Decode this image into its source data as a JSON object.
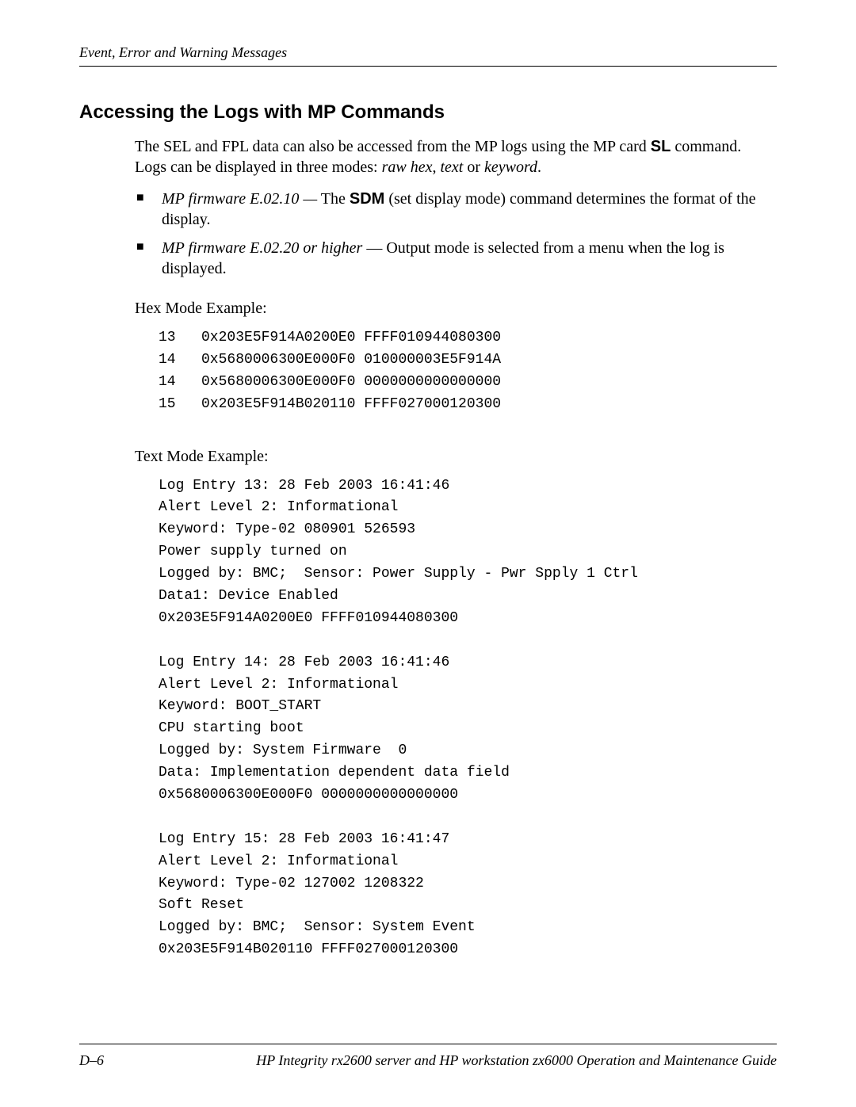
{
  "header": {
    "text": "Event, Error and Warning Messages"
  },
  "section": {
    "title": "Accessing the Logs with MP Commands",
    "intro_part1": "The SEL and FPL data can also be accessed from the MP logs using the MP card ",
    "intro_bold1": "SL",
    "intro_part2": " command. Logs can be displayed in three modes: ",
    "intro_mode1": "raw hex",
    "intro_sep1": ", ",
    "intro_mode2": "text",
    "intro_sep2": " or ",
    "intro_mode3": "keyword",
    "intro_end": "."
  },
  "bullets": {
    "b1_em": "MP firmware E.02.10 —",
    "b1_pre": " The ",
    "b1_bold": "SDM",
    "b1_rest": " (set display mode) command determines the format of the display.",
    "b2_em": "MP firmware E.02.20 or higher",
    "b2_rest": " — Output mode is selected from a menu when the log is displayed."
  },
  "hex": {
    "label": "Hex Mode Example:",
    "lines": "13   0x203E5F914A0200E0 FFFF010944080300\n14   0x5680006300E000F0 010000003E5F914A\n14   0x5680006300E000F0 0000000000000000\n15   0x203E5F914B020110 FFFF027000120300"
  },
  "text": {
    "label": "Text Mode Example:",
    "lines": "Log Entry 13: 28 Feb 2003 16:41:46\nAlert Level 2: Informational\nKeyword: Type-02 080901 526593\nPower supply turned on\nLogged by: BMC;  Sensor: Power Supply - Pwr Spply 1 Ctrl\nData1: Device Enabled\n0x203E5F914A0200E0 FFFF010944080300\n\nLog Entry 14: 28 Feb 2003 16:41:46\nAlert Level 2: Informational\nKeyword: BOOT_START\nCPU starting boot\nLogged by: System Firmware  0\nData: Implementation dependent data field\n0x5680006300E000F0 0000000000000000\n\nLog Entry 15: 28 Feb 2003 16:41:47\nAlert Level 2: Informational\nKeyword: Type-02 127002 1208322\nSoft Reset\nLogged by: BMC;  Sensor: System Event\n0x203E5F914B020110 FFFF027000120300"
  },
  "footer": {
    "page": "D–6",
    "doc": "HP Integrity rx2600 server and HP workstation zx6000 Operation and Maintenance Guide"
  }
}
